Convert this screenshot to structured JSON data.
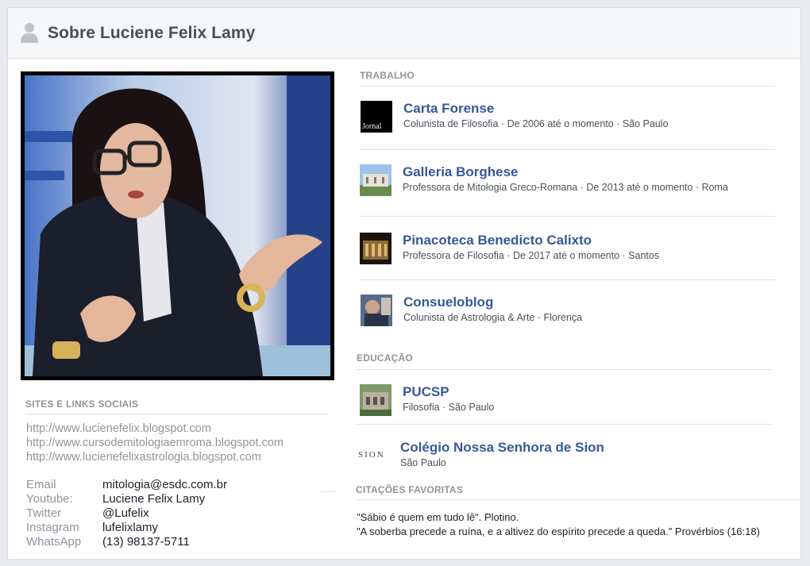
{
  "header": {
    "title": "Sobre Luciene Felix Lamy",
    "icon": "person-icon"
  },
  "sections": {
    "sites": "SITES E LINKS SOCIAIS",
    "work": "TRABALHO",
    "education": "EDUCAÇÃO",
    "quotes": "CITAÇÕES FAVORITAS"
  },
  "sites": [
    "http://www.lucienefelix.blogspot.com",
    "http://www.cursodemitologiaemroma.blogspot.com",
    "http://www.lucienefelixastrologia.blogspot.com"
  ],
  "contacts": [
    {
      "label": "Email",
      "value": "mitologia@esdc.com.br"
    },
    {
      "label": "Youtube:",
      "value": "Luciene Felix Lamy"
    },
    {
      "label": "Twitter",
      "value": "@Lufelix"
    },
    {
      "label": "Instagram",
      "value": "lufelixlamy"
    },
    {
      "label": "WhatsApp",
      "value": "(13) 98137-5711"
    }
  ],
  "work": [
    {
      "name": "Carta Forense",
      "meta": "Colunista de Filosofia · De 2006 até o momento ·  São Paulo",
      "logo_text": "Jornal"
    },
    {
      "name": "Galleria Borghese",
      "meta": "Professora de Mitologia Greco-Romana · De 2013 até o momento · Roma"
    },
    {
      "name": "Pinacoteca Benedicto Calixto",
      "meta": "Professora de Filosofia · De 2017 até o momento · Santos"
    },
    {
      "name": "Consueloblog",
      "meta": "Colunista de Astrologia & Arte · Florença"
    }
  ],
  "education": [
    {
      "name": "PUCSP",
      "meta": "Filosofia · São Paulo"
    },
    {
      "name": "Colégio Nossa Senhora de Sion",
      "meta": "São Paulo",
      "logo_text": "SION"
    }
  ],
  "quotes": [
    "\"Sábio é quem em tudo lê\". Plotino.",
    "\"A soberba precede a ruína, e a altivez do espírito precede a queda.\" Provérbios (16:18)"
  ],
  "colors": {
    "link": "#365899",
    "muted": "#90949c",
    "text": "#1d2129",
    "background": "#e9ebee"
  }
}
